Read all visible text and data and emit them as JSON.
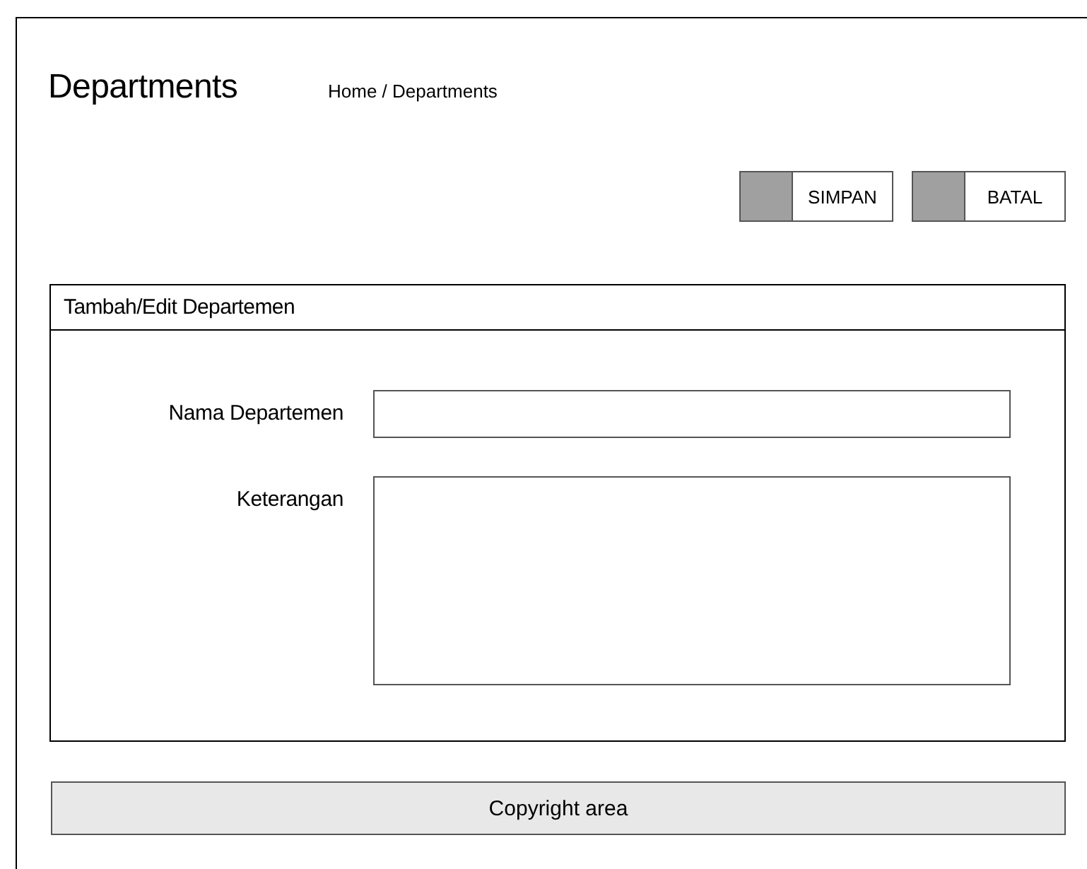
{
  "header": {
    "title": "Departments",
    "breadcrumb": "Home / Departments"
  },
  "buttons": [
    {
      "label": "SIMPAN"
    },
    {
      "label": "BATAL"
    }
  ],
  "form": {
    "title": "Tambah/Edit Departemen",
    "fields": [
      {
        "label": "Nama Departemen",
        "kind": "input"
      },
      {
        "label": "Keterangan",
        "kind": "textarea"
      }
    ]
  },
  "footer": "Copyright area"
}
